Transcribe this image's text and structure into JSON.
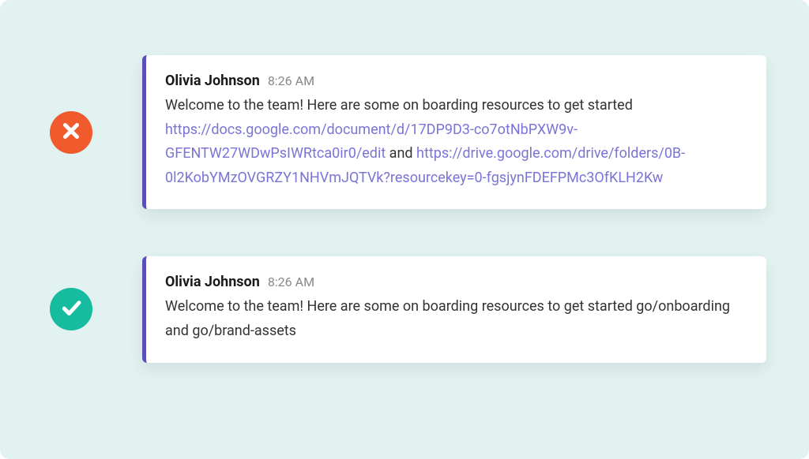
{
  "examples": {
    "bad": {
      "author": "Olivia Johnson",
      "time": "8:26 AM",
      "intro": "Welcome to the team! Here are some on boarding resources to get started ",
      "link1": "https://docs.google.com/document/d/17DP9D3-co7otNbPXW9v-GFENTW27WDwPsIWRtca0ir0/edit",
      "connector": " and ",
      "link2": "https://drive.google.com/drive/folders/0B-0l2KobYMzOVGRZY1NHVmJQTVk?resourcekey=0-fgsjynFDEFPMc3OfKLH2Kw"
    },
    "good": {
      "author": "Olivia Johnson",
      "time": "8:26 AM",
      "text": "Welcome to the team! Here are some on boarding resources to get started go/onboarding and go/brand-assets"
    }
  }
}
